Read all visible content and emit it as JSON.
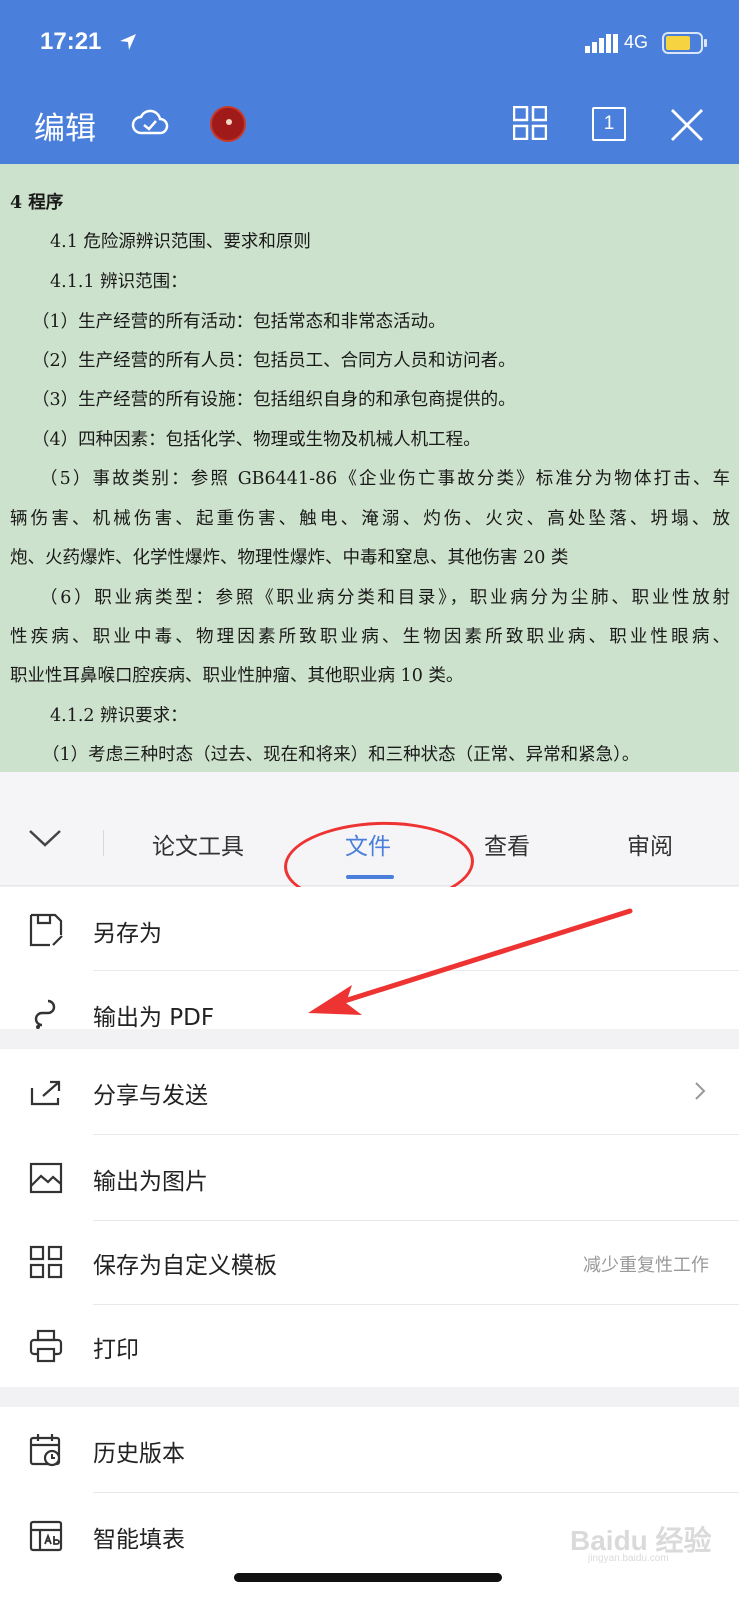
{
  "status": {
    "time": "17:21",
    "network": "4G"
  },
  "header": {
    "edit_label": "编辑",
    "page_count": "1"
  },
  "document": {
    "lines": [
      "4 程序",
      "4.1 危险源辨识范围、要求和原则",
      "4.1.1 辨识范围：",
      "（1）生产经营的所有活动：包括常态和非常态活动。",
      "（2）生产经营的所有人员：包括员工、合同方人员和访问者。",
      "（3）生产经营的所有设施：包括组织自身的和承包商提供的。",
      "（4）四种因素：包括化学、物理或生物及机械人机工程。",
      "（5）事故类别：参照 GB6441-86《企业伤亡事故分类》标准分为物体打击、车",
      "辆伤害、机械伤害、起重伤害、触电、淹溺、灼伤、火灾、高处坠落、坍塌、放",
      "炮、火药爆炸、化学性爆炸、物理性爆炸、中毒和窒息、其他伤害 20 类",
      "（6）职业病类型：参照《职业病分类和目录》，职业病分为尘肺、职业性放射",
      "性疾病、职业中毒、物理因素所致职业病、生物因素所致职业病、职业性眼病、",
      "职业性耳鼻喉口腔疾病、职业性肿瘤、其他职业病 10 类。",
      "4.1.2 辨识要求：",
      "（1）考虑三种时态（过去、现在和将来）和三种状态（正常、异常和紧急）。"
    ]
  },
  "tabs": [
    "论文工具",
    "文件",
    "查看",
    "审阅"
  ],
  "menu": {
    "group1": [
      {
        "label": "另存为",
        "icon": "save-as-icon"
      },
      {
        "label": "输出为 PDF",
        "icon": "pdf-icon"
      }
    ],
    "group2": [
      {
        "label": "分享与发送",
        "icon": "share-icon"
      },
      {
        "label": "输出为图片",
        "icon": "image-icon"
      },
      {
        "label": "保存为自定义模板",
        "icon": "template-icon",
        "hint": "减少重复性工作"
      },
      {
        "label": "打印",
        "icon": "printer-icon"
      }
    ],
    "group3": [
      {
        "label": "历史版本",
        "icon": "history-icon"
      },
      {
        "label": "智能填表",
        "icon": "form-fill-icon"
      }
    ]
  },
  "watermark": {
    "main": "Baidu 经验",
    "sub": "jingyan.baidu.com"
  },
  "colors": {
    "header": "#4a7fdb",
    "document_bg": "#cde2cc",
    "accent": "#4a7fdb",
    "annotation": "#e33333"
  }
}
